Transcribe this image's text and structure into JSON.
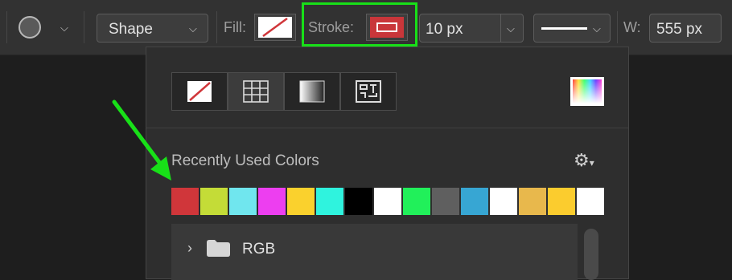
{
  "toolbar": {
    "tool_mode": "Shape",
    "fill_label": "Fill:",
    "stroke_label": "Stroke:",
    "stroke_width": "10 px",
    "width_label": "W:",
    "width_value": "555 px",
    "stroke_color": "#c9363a",
    "highlight_color": "#18e018"
  },
  "panel": {
    "modes": [
      "no-color",
      "solid-color-grid",
      "gradient",
      "pattern"
    ],
    "recent_title": "Recently Used Colors",
    "swatches": [
      "#d0363a",
      "#c4dc37",
      "#70e6ee",
      "#ed3ef0",
      "#fad12d",
      "#2ff3de",
      "#000000",
      "#ffffff",
      "#21f05a",
      "#5f5f5f",
      "#37a6d3",
      "#ffffff",
      "#e8b84c",
      "#fbcc2e",
      "#ffffff"
    ],
    "groups": [
      {
        "label": "RGB"
      }
    ]
  },
  "annotation": {
    "arrow_color": "#18e018"
  }
}
